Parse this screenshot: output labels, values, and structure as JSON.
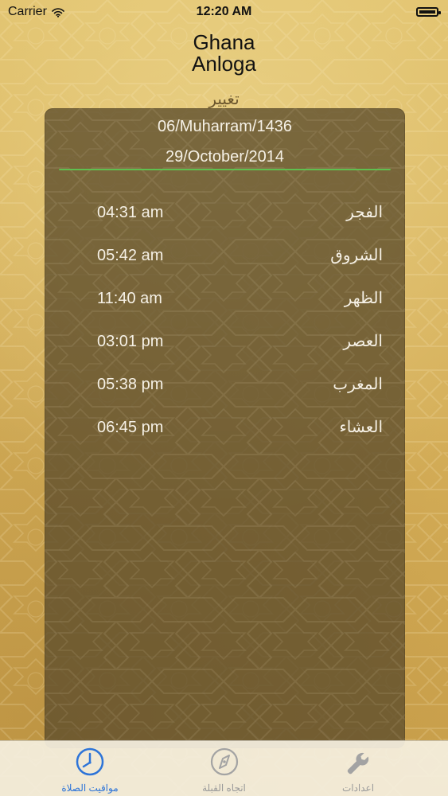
{
  "status_bar": {
    "carrier": "Carrier",
    "time": "12:20 AM",
    "wifi_icon": "wifi-icon",
    "battery_icon": "battery-icon"
  },
  "location": {
    "country": "Ghana",
    "city": "Anloga",
    "change_label": "تغيير"
  },
  "dates": {
    "hijri": "06/Muharram/1436",
    "gregorian": "29/October/2014"
  },
  "prayer_times": [
    {
      "name": "الفجر",
      "time": "04:31 am"
    },
    {
      "name": "الشروق",
      "time": "05:42 am"
    },
    {
      "name": "الظهر",
      "time": "11:40 am"
    },
    {
      "name": "العصر",
      "time": "03:01 pm"
    },
    {
      "name": "المغرب",
      "time": "05:38 pm"
    },
    {
      "name": "العشاء",
      "time": "06:45 pm"
    }
  ],
  "tabbar": {
    "tabs": [
      {
        "label": "مواقيت الصلاة",
        "icon": "clock-icon",
        "active": true
      },
      {
        "label": "اتجاه القبلة",
        "icon": "compass-icon",
        "active": false
      },
      {
        "label": "اعدادات",
        "icon": "wrench-icon",
        "active": false
      }
    ]
  },
  "colors": {
    "background": "#d8b45f",
    "panel": "#5e4e2c",
    "divider": "#5fbf4f",
    "active_tab": "#2d74d8"
  }
}
